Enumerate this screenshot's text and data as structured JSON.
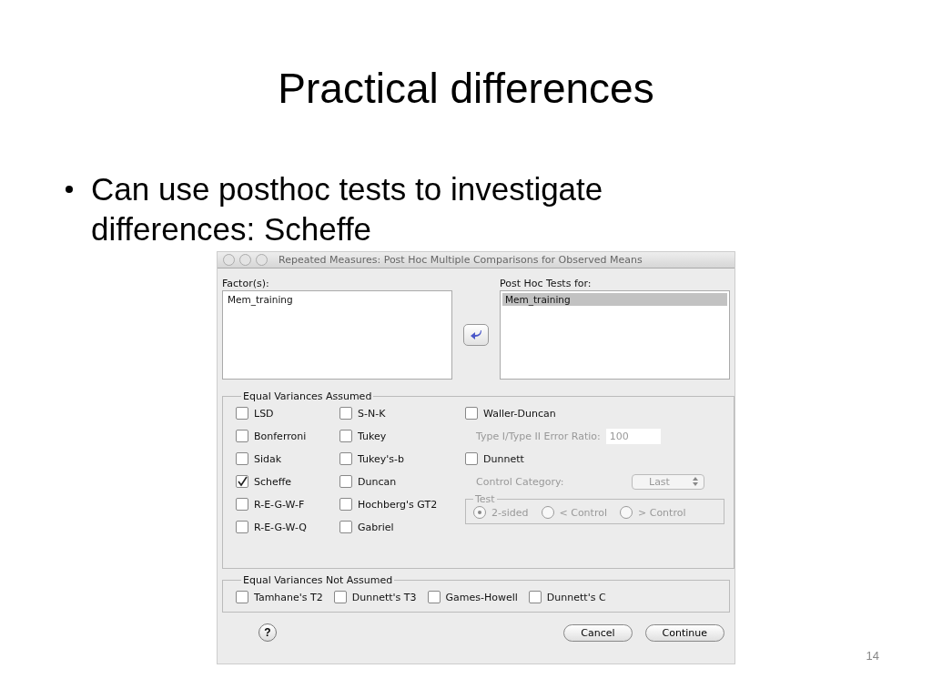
{
  "slide": {
    "title": "Practical differences",
    "bullets": [
      "Can use posthoc tests to investigate differences: Scheffe"
    ],
    "number": "14"
  },
  "dialog": {
    "title": "Repeated Measures: Post Hoc Multiple Comparisons for Observed Means",
    "factors": {
      "label": "Factor(s):",
      "items": [
        {
          "label": "Mem_training",
          "selected": false
        }
      ]
    },
    "posthoc": {
      "label": "Post Hoc Tests for:",
      "items": [
        {
          "label": "Mem_training",
          "selected": true
        }
      ]
    },
    "assumed": {
      "legend": "Equal Variances Assumed",
      "column_1": [
        {
          "label": "LSD",
          "checked": false
        },
        {
          "label": "Bonferroni",
          "checked": false
        },
        {
          "label": "Sidak",
          "checked": false
        },
        {
          "label": "Scheffe",
          "checked": true
        },
        {
          "label": "R-E-G-W-F",
          "checked": false
        },
        {
          "label": "R-E-G-W-Q",
          "checked": false
        }
      ],
      "column_2": [
        {
          "label": "S-N-K",
          "checked": false
        },
        {
          "label": "Tukey",
          "checked": false
        },
        {
          "label": "Tukey's-b",
          "checked": false
        },
        {
          "label": "Duncan",
          "checked": false
        },
        {
          "label": "Hochberg's GT2",
          "checked": false
        },
        {
          "label": "Gabriel",
          "checked": false
        }
      ],
      "waller_duncan": {
        "label": "Waller-Duncan",
        "checked": false
      },
      "ratio": {
        "label": "Type I/Type II Error Ratio:",
        "value": "100",
        "disabled": true
      },
      "dunnett": {
        "label": "Dunnett",
        "checked": false
      },
      "control_category": {
        "label": "Control Category:",
        "value": "Last",
        "disabled": true
      },
      "test": {
        "legend": "Test",
        "disabled": true,
        "options": [
          {
            "label": "2-sided",
            "selected": true
          },
          {
            "label": "< Control",
            "selected": false
          },
          {
            "label": "> Control",
            "selected": false
          }
        ]
      }
    },
    "not_assumed": {
      "legend": "Equal Variances Not Assumed",
      "tests": [
        {
          "label": "Tamhane's T2",
          "checked": false
        },
        {
          "label": "Dunnett's T3",
          "checked": false
        },
        {
          "label": "Games-Howell",
          "checked": false
        },
        {
          "label": "Dunnett's C",
          "checked": false
        }
      ]
    },
    "help": "?",
    "buttons": [
      "Cancel",
      "Continue"
    ]
  }
}
